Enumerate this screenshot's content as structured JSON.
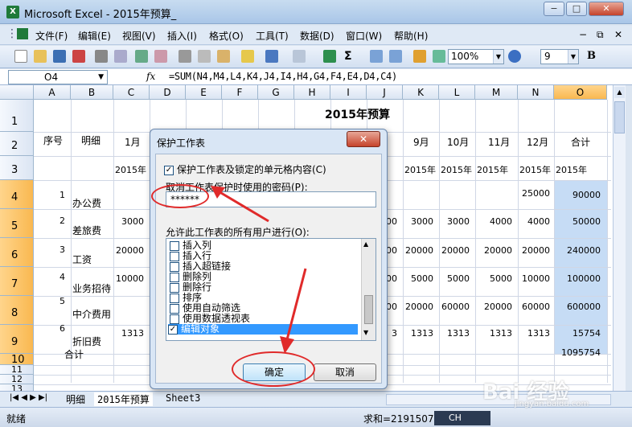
{
  "window": {
    "title": "Microsoft Excel - 2015年预算_",
    "app_icon": "X",
    "minimize": "−",
    "restore": "□",
    "close": "✕"
  },
  "menu": {
    "items": [
      "文件(F)",
      "编辑(E)",
      "视图(V)",
      "插入(I)",
      "格式(O)",
      "工具(T)",
      "数据(D)",
      "窗口(W)",
      "帮助(H)"
    ]
  },
  "toolbar": {
    "zoom": "100%",
    "font_size": "9",
    "bold": "B",
    "sum_symbol": "Σ"
  },
  "formula_bar": {
    "name_box": "O4",
    "fx": "fx",
    "formula": "=SUM(N4,M4,L4,K4,J4,I4,H4,G4,F4,E4,D4,C4)"
  },
  "columns": [
    "A",
    "B",
    "C",
    "D",
    "E",
    "F",
    "G",
    "H",
    "I",
    "J",
    "K",
    "L",
    "M",
    "N",
    "O"
  ],
  "rows": [
    "1",
    "2",
    "3",
    "4",
    "5",
    "6",
    "7",
    "8",
    "9",
    "10",
    "11",
    "12",
    "13"
  ],
  "sheet": {
    "title": "2015年预算",
    "seq_header": "序号",
    "detail_header": "明细",
    "month_headers": {
      "c": "1月",
      "j": "9月",
      "k": "10月",
      "l": "11月",
      "m": "12月",
      "total": "合计"
    },
    "year_label": "2015年",
    "data_rows": [
      {
        "seq": "1",
        "name": "办公费",
        "c": "",
        "d": "",
        "j": "",
        "k": "",
        "l": "",
        "m": "",
        "n": "25000",
        "o": "90000"
      },
      {
        "seq": "2",
        "name": "差旅费",
        "c": "3000",
        "d": "",
        "j": "00",
        "k": "3000",
        "l": "3000",
        "m": "4000",
        "n": "4000",
        "o": "50000"
      },
      {
        "seq": "3",
        "name": "工资",
        "c": "20000",
        "d": "",
        "j": "00",
        "k": "20000",
        "l": "20000",
        "m": "20000",
        "n": "20000",
        "o": "240000"
      },
      {
        "seq": "4",
        "name": "业务招待",
        "c": "10000",
        "d": "",
        "j": "00",
        "k": "5000",
        "l": "5000",
        "m": "5000",
        "n": "10000",
        "o": "100000"
      },
      {
        "seq": "5",
        "name": "中介费用",
        "c": "",
        "d": "",
        "j": "00",
        "k": "20000",
        "l": "60000",
        "m": "20000",
        "n": "60000",
        "o": "600000"
      },
      {
        "seq": "6",
        "name": "折旧费",
        "c": "1313",
        "d": "",
        "j": "3",
        "k": "1313",
        "l": "1313",
        "m": "1313",
        "n": "1313",
        "o": "15754"
      }
    ],
    "total_label": "合计",
    "grand_total": "1095754"
  },
  "sheet_tabs": [
    "明细",
    "2015年预算",
    "Sheet3"
  ],
  "status": {
    "ready": "就绪",
    "sum": "求和=2191507",
    "ime": "CH",
    "watermark": "Bai 经验",
    "watermark_url": "jingyan.baidu.com"
  },
  "dialog": {
    "title": "保护工作表",
    "close": "✕",
    "protect_label": "保护工作表及锁定的单元格内容(C)",
    "password_label": "取消工作表保护时使用的密码(P):",
    "password_value": "******",
    "allow_label": "允许此工作表的所有用户进行(O):",
    "permissions": [
      "插入列",
      "插入行",
      "插入超链接",
      "删除列",
      "删除行",
      "排序",
      "使用自动筛选",
      "使用数据透视表",
      "编辑对象"
    ],
    "checked": [
      false,
      false,
      false,
      false,
      false,
      false,
      false,
      false,
      true
    ],
    "ok": "确定",
    "cancel": "取消"
  }
}
